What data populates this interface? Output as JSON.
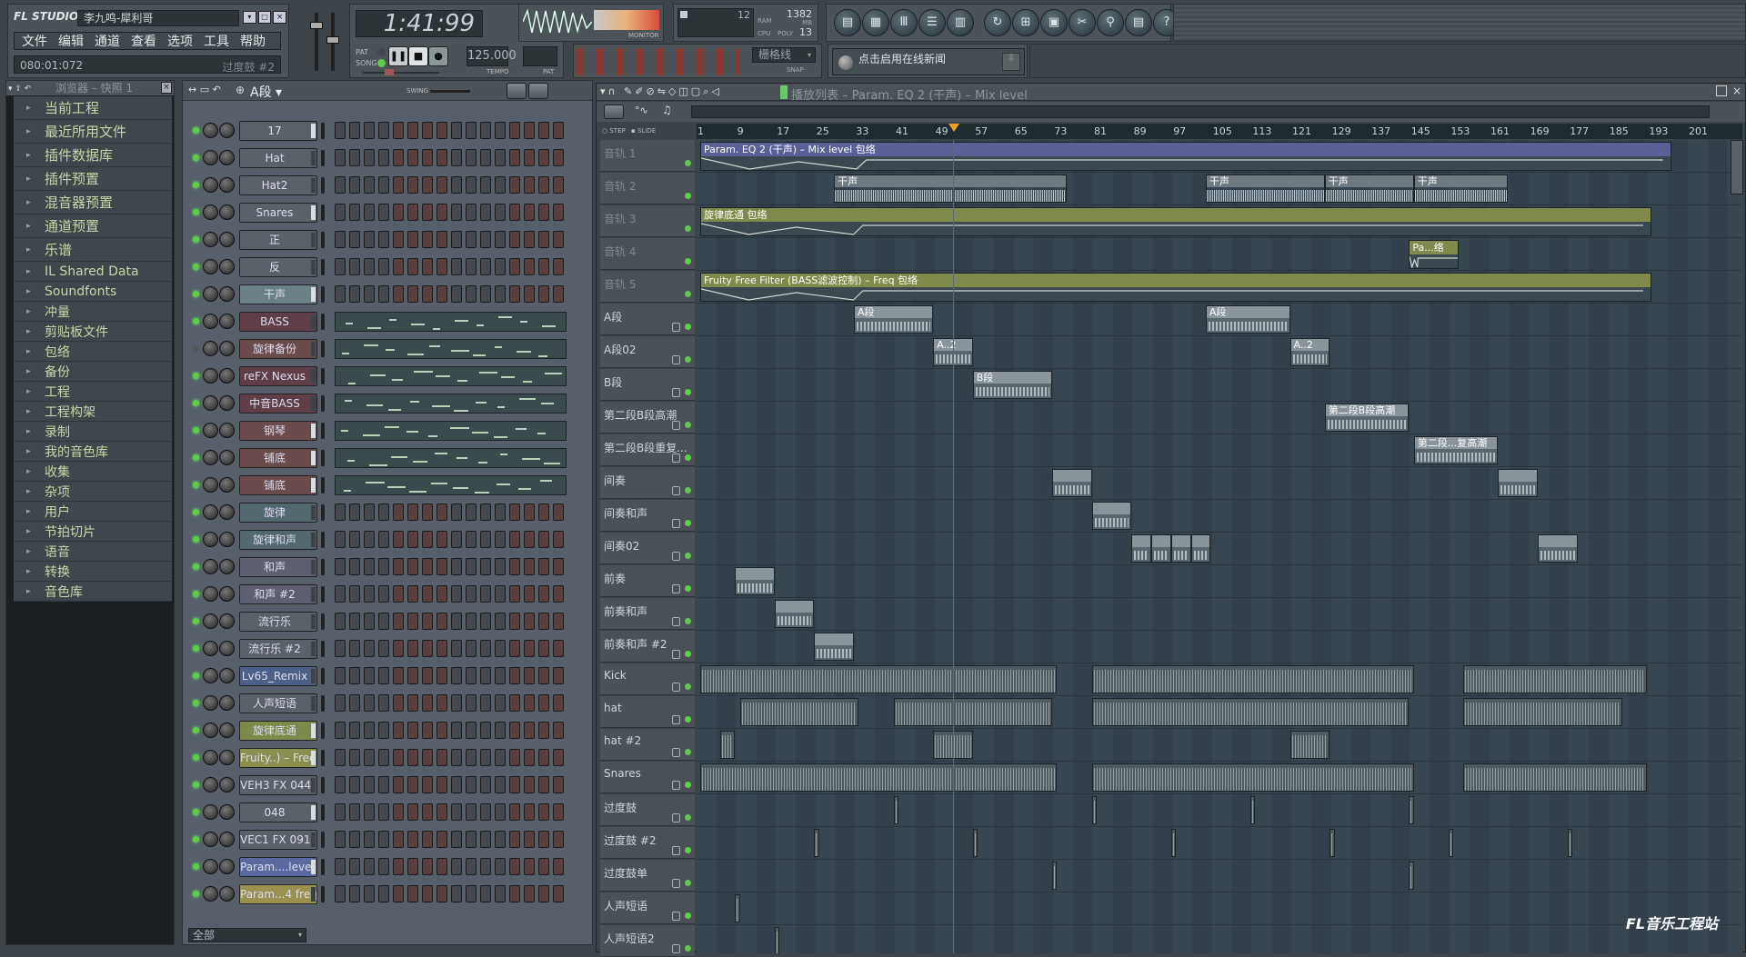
{
  "app": {
    "logo": "FL STUDIO",
    "project_title": "李九鸣-犀利哥",
    "menu": [
      "文件",
      "编辑",
      "通道",
      "查看",
      "选项",
      "工具",
      "帮助"
    ],
    "hint_time": "080:01:072",
    "hint_text": "过度鼓 #2"
  },
  "transport": {
    "time": "1:41:99",
    "pat_label": "PAT",
    "song_label": "SONG",
    "mode": "song",
    "tempo": "125.000",
    "tempo_label": "TEMPO",
    "pat_display_label": "PAT",
    "monitor_label": "MONITOR"
  },
  "perf": {
    "cpu_value": "12",
    "ram_mb": "1382",
    "ram_label": "RAM",
    "mb_label": "MB",
    "cpu_label": "CPU",
    "poly_label": "POLY",
    "poly": "13"
  },
  "snap": {
    "value": "栅格线",
    "label": "SNAP"
  },
  "news": {
    "text": "点击启用在线新闻"
  },
  "toolbar_icons": [
    "playlist-icon",
    "step-sequencer-icon",
    "piano-roll-icon",
    "browser-icon",
    "mixer-icon",
    "undo-icon",
    "save-new-icon",
    "export-wave-icon",
    "cut-icon",
    "record-icon",
    "project-info-icon",
    "help-icon"
  ],
  "browser": {
    "title": "浏览器 – 快照 1",
    "items": [
      {
        "label": "当前工程",
        "size": "big"
      },
      {
        "label": "最近所用文件",
        "size": "big"
      },
      {
        "label": "插件数据库",
        "size": "big"
      },
      {
        "label": "插件预置",
        "size": "big"
      },
      {
        "label": "混音器预置",
        "size": "big"
      },
      {
        "label": "通道预置",
        "size": "big"
      },
      {
        "label": "乐谱",
        "size": "big"
      },
      {
        "label": "IL Shared Data",
        "size": "sm"
      },
      {
        "label": "Soundfonts",
        "size": "sm"
      },
      {
        "label": "冲量",
        "size": "sm"
      },
      {
        "label": "剪贴板文件",
        "size": "sm"
      },
      {
        "label": "包络",
        "size": "sm"
      },
      {
        "label": "备份",
        "size": "sm"
      },
      {
        "label": "工程",
        "size": "sm"
      },
      {
        "label": "工程构架",
        "size": "sm"
      },
      {
        "label": "录制",
        "size": "sm"
      },
      {
        "label": "我的音色库",
        "size": "sm"
      },
      {
        "label": "收集",
        "size": "sm"
      },
      {
        "label": "杂项",
        "size": "sm"
      },
      {
        "label": "用户",
        "size": "sm"
      },
      {
        "label": "节拍切片",
        "size": "sm"
      },
      {
        "label": "语音",
        "size": "sm"
      },
      {
        "label": "转换",
        "size": "sm"
      },
      {
        "label": "音色库",
        "size": "sm"
      }
    ]
  },
  "rack": {
    "pattern": "A段",
    "swing_label": "SWING",
    "filter": "全部",
    "channels": [
      {
        "name": "17",
        "color": "#5a6168",
        "marker": true,
        "view": "steps"
      },
      {
        "name": "Hat",
        "color": "#5a6168",
        "marker": false,
        "view": "steps"
      },
      {
        "name": "Hat2",
        "color": "#5a6168",
        "marker": false,
        "view": "steps"
      },
      {
        "name": "Snares",
        "color": "#5a6168",
        "marker": true,
        "view": "steps"
      },
      {
        "name": "正",
        "color": "#5a6168",
        "marker": false,
        "view": "steps"
      },
      {
        "name": "反",
        "color": "#5a6168",
        "marker": false,
        "view": "steps"
      },
      {
        "name": "干声",
        "color": "#6b8084",
        "marker": true,
        "view": "steps"
      },
      {
        "name": "BASS",
        "color": "#5e3f47",
        "marker": false,
        "view": "piano"
      },
      {
        "name": "旋律备份",
        "color": "#6b4c4c",
        "marker": false,
        "view": "piano",
        "muted": true
      },
      {
        "name": "reFX Nexus",
        "color": "#5e3f47",
        "marker": false,
        "view": "piano"
      },
      {
        "name": "中音BASS",
        "color": "#5e3f47",
        "marker": false,
        "view": "piano"
      },
      {
        "name": "钢琴",
        "color": "#6b4c4c",
        "marker": true,
        "view": "piano"
      },
      {
        "name": "铺底",
        "color": "#6b4c4c",
        "marker": true,
        "view": "piano"
      },
      {
        "name": "铺底",
        "color": "#6b4c4c",
        "marker": true,
        "view": "piano"
      },
      {
        "name": "旋律",
        "color": "#52676e",
        "marker": false,
        "view": "steps"
      },
      {
        "name": "旋律和声",
        "color": "#52676e",
        "marker": false,
        "view": "steps"
      },
      {
        "name": "和声",
        "color": "#5e6072",
        "marker": false,
        "view": "steps"
      },
      {
        "name": "和声 #2",
        "color": "#5e6072",
        "marker": false,
        "view": "steps"
      },
      {
        "name": "流行乐",
        "color": "#5a6168",
        "marker": false,
        "view": "steps"
      },
      {
        "name": "流行乐 #2",
        "color": "#5a6168",
        "marker": false,
        "view": "steps"
      },
      {
        "name": "Lv65_Remix",
        "color": "#4f6088",
        "marker": false,
        "view": "steps"
      },
      {
        "name": "人声短语",
        "color": "#5a6168",
        "marker": false,
        "view": "steps"
      },
      {
        "name": "旋律底通",
        "color": "#7d8a4c",
        "marker": true,
        "view": "steps"
      },
      {
        "name": "Fruity..) – Freq",
        "color": "#8a8f50",
        "marker": true,
        "view": "steps"
      },
      {
        "name": "VEH3 FX 044",
        "color": "#5a6168",
        "marker": false,
        "view": "steps"
      },
      {
        "name": "048",
        "color": "#5a6168",
        "marker": true,
        "view": "steps"
      },
      {
        "name": "VEC1 FX 091",
        "color": "#5a6168",
        "marker": false,
        "view": "steps"
      },
      {
        "name": "Param....level",
        "color": "#5a6aa0",
        "marker": true,
        "view": "steps"
      },
      {
        "name": "Param...4 freq",
        "color": "#9a9050",
        "marker": false,
        "view": "steps"
      }
    ]
  },
  "playlist": {
    "title": "播放列表 – Param. EQ 2 (干声) – Mix level",
    "step_label": "STEP",
    "slide_label": "SLIDE",
    "ruler": [
      1,
      9,
      17,
      25,
      33,
      41,
      49,
      57,
      65,
      73,
      81,
      89,
      97,
      105,
      113,
      121,
      129,
      137,
      145,
      153,
      161,
      169,
      177,
      185,
      193,
      201
    ],
    "song_position_bar": 52,
    "tracks": [
      {
        "name": "音轨 1",
        "dim": true,
        "clips": [
          {
            "label": "Param. EQ 2 (干声) – Mix level 包络",
            "start": 1,
            "len": 196,
            "kind": "auto",
            "color": "#5b6096"
          }
        ]
      },
      {
        "name": "音轨 2",
        "dim": true,
        "clips": [
          {
            "label": "干声",
            "start": 28,
            "len": 47,
            "kind": "aud"
          },
          {
            "label": "干声",
            "start": 103,
            "len": 24,
            "kind": "aud"
          },
          {
            "label": "干声",
            "start": 127,
            "len": 18,
            "kind": "aud"
          },
          {
            "label": "干声",
            "start": 145,
            "len": 19,
            "kind": "aud"
          }
        ]
      },
      {
        "name": "音轨 3",
        "dim": true,
        "clips": [
          {
            "label": "旋律底通 包络",
            "start": 1,
            "len": 192,
            "kind": "auto",
            "color": "#7f8a4c"
          }
        ]
      },
      {
        "name": "音轨 4",
        "dim": true,
        "clips": [
          {
            "label": "Pa...络",
            "start": 144,
            "len": 10,
            "kind": "auto",
            "color": "#7f8a4c"
          }
        ]
      },
      {
        "name": "音轨 5",
        "dim": true,
        "clips": [
          {
            "label": "Fruity Free Filter (BASS滤波控制) – Freq 包络",
            "start": 1,
            "len": 192,
            "kind": "auto",
            "color": "#7f8a4c"
          }
        ]
      },
      {
        "name": "A段",
        "clips": [
          {
            "label": "A段",
            "start": 32,
            "len": 16,
            "kind": "pat"
          },
          {
            "label": "A段",
            "start": 103,
            "len": 17,
            "kind": "pat"
          }
        ]
      },
      {
        "name": "A段02",
        "clips": [
          {
            "label": "A..2",
            "start": 48,
            "len": 8,
            "kind": "pat"
          },
          {
            "label": "A..2",
            "start": 120,
            "len": 8,
            "kind": "pat"
          }
        ]
      },
      {
        "name": "B段",
        "clips": [
          {
            "label": "B段",
            "start": 56,
            "len": 16,
            "kind": "pat"
          }
        ]
      },
      {
        "name": "第二段B段高潮",
        "clips": [
          {
            "label": "第二段B段高潮",
            "start": 127,
            "len": 17,
            "kind": "pat"
          }
        ]
      },
      {
        "name": "第二段B段重复...",
        "clips": [
          {
            "label": "第二段...复高潮",
            "start": 145,
            "len": 17,
            "kind": "pat"
          }
        ]
      },
      {
        "name": "间奏",
        "clips": [
          {
            "label": "",
            "start": 72,
            "len": 8,
            "kind": "pat"
          },
          {
            "label": "",
            "start": 162,
            "len": 8,
            "kind": "pat"
          }
        ]
      },
      {
        "name": "间奏和声",
        "clips": [
          {
            "label": "",
            "start": 80,
            "len": 8,
            "kind": "pat"
          }
        ]
      },
      {
        "name": "间奏02",
        "clips": [
          {
            "label": "",
            "start": 88,
            "len": 4,
            "kind": "pat"
          },
          {
            "label": "",
            "start": 92,
            "len": 4,
            "kind": "pat"
          },
          {
            "label": "",
            "start": 96,
            "len": 4,
            "kind": "pat"
          },
          {
            "label": "",
            "start": 100,
            "len": 4,
            "kind": "pat"
          },
          {
            "label": "",
            "start": 170,
            "len": 8,
            "kind": "pat"
          }
        ]
      },
      {
        "name": "前奏",
        "clips": [
          {
            "label": "",
            "start": 8,
            "len": 8,
            "kind": "pat"
          }
        ]
      },
      {
        "name": "前奏和声",
        "clips": [
          {
            "label": "",
            "start": 16,
            "len": 8,
            "kind": "pat"
          }
        ]
      },
      {
        "name": "前奏和声 #2",
        "clips": [
          {
            "label": "",
            "start": 24,
            "len": 8,
            "kind": "pat"
          }
        ]
      },
      {
        "name": "Kick",
        "clips": [
          {
            "label": "",
            "start": 1,
            "len": 72,
            "kind": "drum"
          },
          {
            "label": "",
            "start": 80,
            "len": 65,
            "kind": "drum"
          },
          {
            "label": "",
            "start": 155,
            "len": 37,
            "kind": "drum"
          }
        ]
      },
      {
        "name": "hat",
        "clips": [
          {
            "label": "",
            "start": 9,
            "len": 24,
            "kind": "drum"
          },
          {
            "label": "",
            "start": 40,
            "len": 32,
            "kind": "drum"
          },
          {
            "label": "",
            "start": 80,
            "len": 64,
            "kind": "drum"
          },
          {
            "label": "",
            "start": 155,
            "len": 32,
            "kind": "drum"
          }
        ]
      },
      {
        "name": "hat #2",
        "clips": [
          {
            "label": "",
            "start": 5,
            "len": 3,
            "kind": "drum"
          },
          {
            "label": "",
            "start": 48,
            "len": 8,
            "kind": "drum"
          },
          {
            "label": "",
            "start": 120,
            "len": 8,
            "kind": "drum"
          }
        ]
      },
      {
        "name": "Snares",
        "clips": [
          {
            "label": "",
            "start": 1,
            "len": 72,
            "kind": "drum"
          },
          {
            "label": "",
            "start": 80,
            "len": 65,
            "kind": "drum"
          },
          {
            "label": "",
            "start": 155,
            "len": 37,
            "kind": "drum"
          }
        ]
      },
      {
        "name": "过度鼓",
        "clips": [
          {
            "label": "",
            "start": 40,
            "len": 1,
            "kind": "drum"
          },
          {
            "label": "",
            "start": 80,
            "len": 1,
            "kind": "drum"
          },
          {
            "label": "",
            "start": 112,
            "len": 1,
            "kind": "drum"
          },
          {
            "label": "",
            "start": 144,
            "len": 1,
            "kind": "drum"
          }
        ]
      },
      {
        "name": "过度鼓 #2",
        "clips": [
          {
            "label": "",
            "start": 24,
            "len": 1,
            "kind": "drum"
          },
          {
            "label": "",
            "start": 56,
            "len": 1,
            "kind": "drum"
          },
          {
            "label": "",
            "start": 96,
            "len": 1,
            "kind": "drum"
          },
          {
            "label": "",
            "start": 128,
            "len": 1,
            "kind": "drum"
          },
          {
            "label": "",
            "start": 152,
            "len": 1,
            "kind": "drum"
          },
          {
            "label": "",
            "start": 176,
            "len": 1,
            "kind": "drum"
          }
        ]
      },
      {
        "name": "过度鼓单",
        "clips": [
          {
            "label": "",
            "start": 72,
            "len": 1,
            "kind": "drum"
          },
          {
            "label": "",
            "start": 144,
            "len": 1,
            "kind": "drum"
          }
        ]
      },
      {
        "name": "人声短语",
        "clips": [
          {
            "label": "",
            "start": 8,
            "len": 1,
            "kind": "drum"
          }
        ]
      },
      {
        "name": "人声短语2",
        "clips": [
          {
            "label": "",
            "start": 16,
            "len": 1,
            "kind": "drum"
          }
        ]
      }
    ]
  },
  "watermark": "FL音乐工程站"
}
